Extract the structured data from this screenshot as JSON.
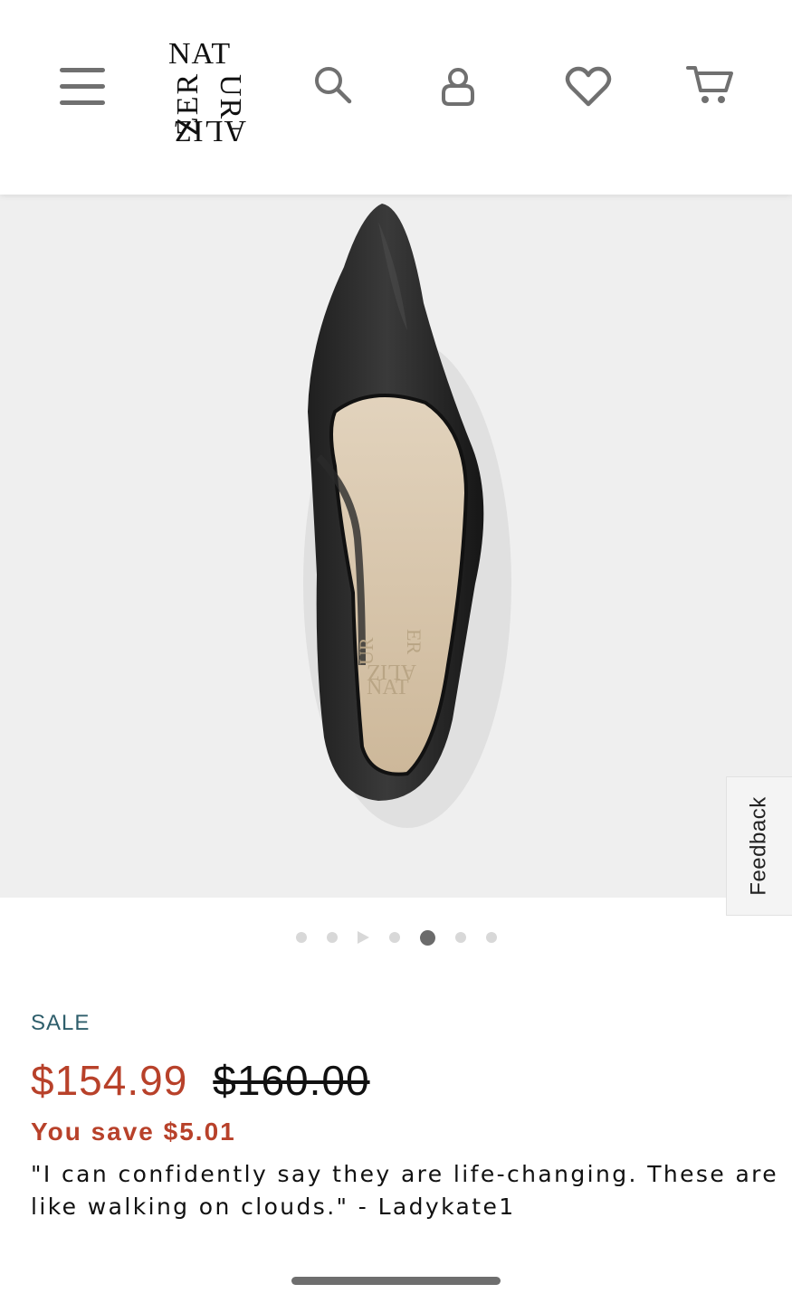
{
  "header": {
    "brand_logo_text": "NATURALIZER",
    "menu_icon": "hamburger-menu-icon",
    "search_icon": "search-icon",
    "account_icon": "account-icon",
    "wishlist_icon": "heart-icon",
    "cart_icon": "cart-icon"
  },
  "gallery": {
    "image_alt": "Black leather pointed-toe pump, top view",
    "insole_brand": "NATURALIZER",
    "feedback_label": "Feedback",
    "dots_total": 7,
    "active_index": 4
  },
  "product": {
    "sale_label": "SALE",
    "price_sale": "$154.99",
    "price_original": "$160.00",
    "you_save": "You save $5.01",
    "quote": "\"I can confidently say they are life-changing. These are like walking on clouds.\" - Ladykate1"
  },
  "colors": {
    "sale_red": "#b8412a",
    "teal": "#2e5e6b",
    "gallery_bg": "#efefef"
  }
}
